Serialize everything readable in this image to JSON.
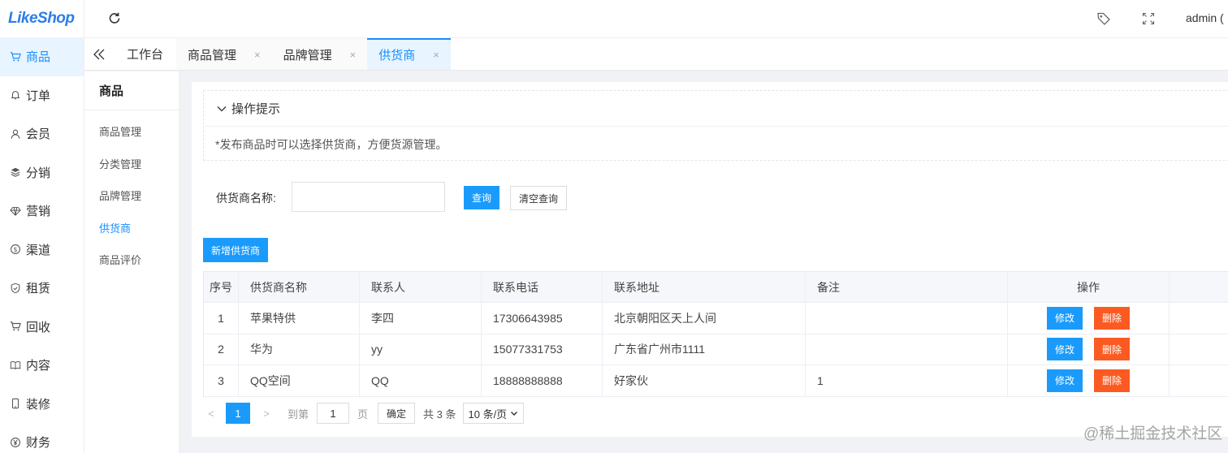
{
  "app": {
    "logo": "LikeShop",
    "user": "admin ("
  },
  "sidebar": {
    "items": [
      {
        "label": "商品",
        "icon": "cart-icon",
        "active": true
      },
      {
        "label": "订单",
        "icon": "bell-icon"
      },
      {
        "label": "会员",
        "icon": "user-icon"
      },
      {
        "label": "分销",
        "icon": "layers-icon"
      },
      {
        "label": "营销",
        "icon": "diamond-icon"
      },
      {
        "label": "渠道",
        "icon": "coin-icon"
      },
      {
        "label": "租赁",
        "icon": "shield-icon"
      },
      {
        "label": "回收",
        "icon": "cart-icon"
      },
      {
        "label": "内容",
        "icon": "book-icon"
      },
      {
        "label": "装修",
        "icon": "phone-icon"
      },
      {
        "label": "财务",
        "icon": "yen-icon"
      }
    ]
  },
  "tabs": [
    {
      "label": "工作台",
      "closable": false
    },
    {
      "label": "商品管理",
      "closable": true,
      "close": "×"
    },
    {
      "label": "品牌管理",
      "closable": true,
      "close": "×"
    },
    {
      "label": "供货商",
      "closable": true,
      "close": "×",
      "active": true
    }
  ],
  "subnav": {
    "title": "商品",
    "items": [
      {
        "label": "商品管理"
      },
      {
        "label": "分类管理"
      },
      {
        "label": "品牌管理"
      },
      {
        "label": "供货商",
        "active": true
      },
      {
        "label": "商品评价"
      }
    ]
  },
  "tips": {
    "title": "操作提示",
    "text": "*发布商品时可以选择供货商，方便货源管理。"
  },
  "search": {
    "label": "供货商名称:",
    "value": "",
    "query_button": "查询",
    "clear_button": "清空查询"
  },
  "add_button": "新增供货商",
  "table": {
    "headers": [
      "序号",
      "供货商名称",
      "联系人",
      "联系电话",
      "联系地址",
      "备注",
      "操作"
    ],
    "rows": [
      {
        "no": "1",
        "name": "苹果特供",
        "contact": "李四",
        "phone": "17306643985",
        "address": "北京朝阳区天上人间",
        "note": ""
      },
      {
        "no": "2",
        "name": "华为",
        "contact": "yy",
        "phone": "15077331753",
        "address": "广东省广州市1111",
        "note": ""
      },
      {
        "no": "3",
        "name": "QQ空间",
        "contact": "QQ",
        "phone": "18888888888",
        "address": "好家伙",
        "note": "1"
      }
    ],
    "edit_label": "修改",
    "delete_label": "删除"
  },
  "pagination": {
    "prev": "<",
    "next": ">",
    "current": "1",
    "goto_label": "到第",
    "goto_value": "1",
    "page_label": "页",
    "confirm": "确定",
    "total": "共 3 条",
    "page_size": "10 条/页"
  },
  "watermark": "@稀土掘金技术社区",
  "colors": {
    "primary": "#1a9bfc",
    "danger": "#fb5b22",
    "active_bg": "#e8f4ff"
  }
}
